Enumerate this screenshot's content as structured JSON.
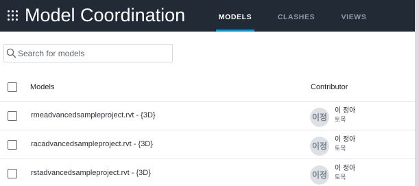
{
  "header": {
    "app_menu_icon": "grid-icon",
    "title": "Model Coordination",
    "tabs": [
      {
        "label": "MODELS",
        "active": true
      },
      {
        "label": "CLASHES",
        "active": false
      },
      {
        "label": "VIEWS",
        "active": false
      }
    ],
    "accent_color": "#0696d7",
    "background_color": "#222a36"
  },
  "search": {
    "icon": "search-icon",
    "placeholder": "Search for models",
    "value": ""
  },
  "table": {
    "columns": {
      "models": "Models",
      "contributor": "Contributor"
    },
    "rows": [
      {
        "model": "rmeadvancedsampleproject.rvt - {3D}",
        "avatar": "이정",
        "contributor_name": "이 정아",
        "contributor_sub": "토목"
      },
      {
        "model": "racadvancedsampleproject.rvt - {3D}",
        "avatar": "이정",
        "contributor_name": "이 정아",
        "contributor_sub": "토목"
      },
      {
        "model": "rstadvancedsampleproject.rvt - {3D}",
        "avatar": "이정",
        "contributor_name": "이 정아",
        "contributor_sub": "토목"
      }
    ]
  }
}
